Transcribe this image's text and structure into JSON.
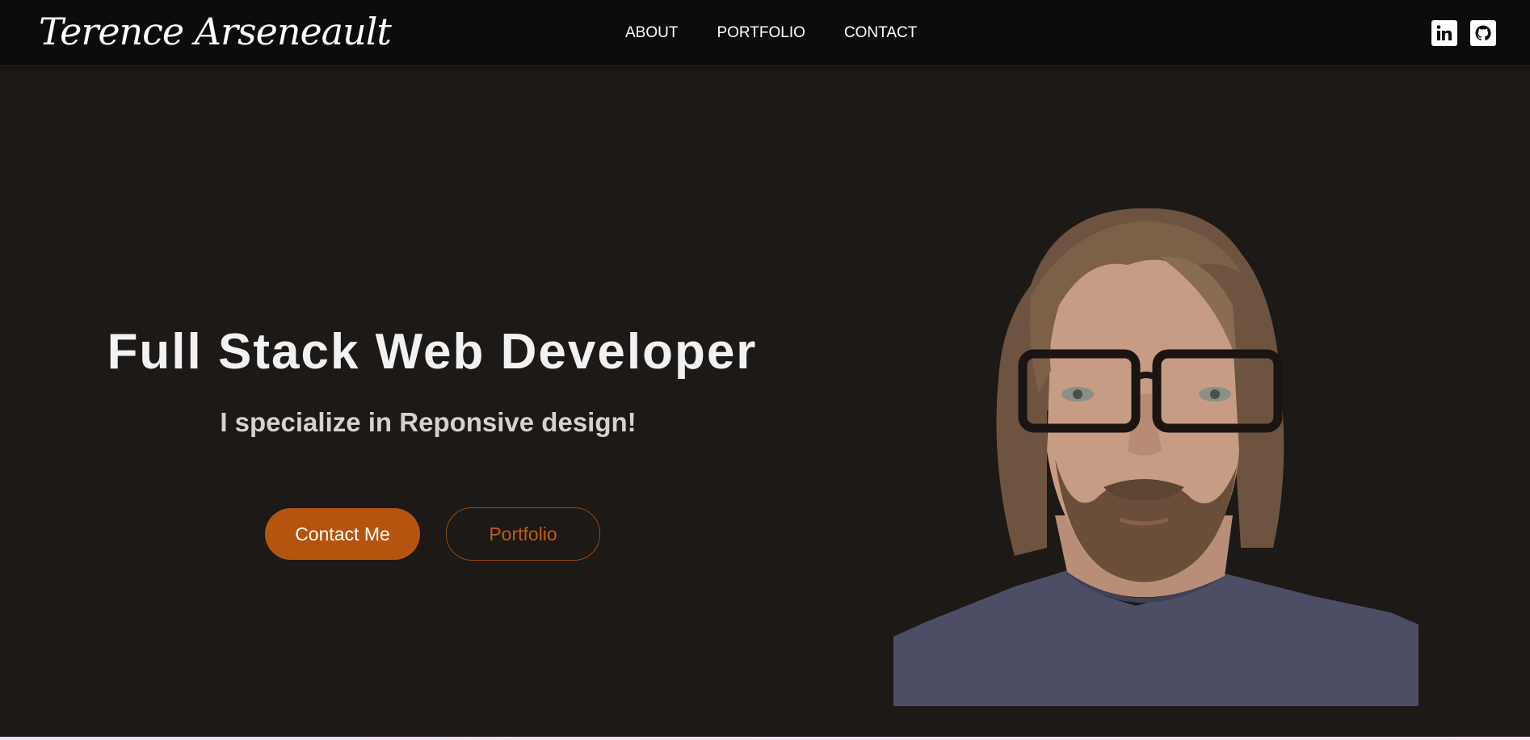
{
  "header": {
    "brand": "Terence Arseneault",
    "nav": [
      {
        "label": "ABOUT"
      },
      {
        "label": "PORTFOLIO"
      },
      {
        "label": "CONTACT"
      }
    ],
    "socials": [
      {
        "icon": "linkedin-icon"
      },
      {
        "icon": "github-icon"
      }
    ]
  },
  "hero": {
    "title": "Full Stack Web Developer",
    "subtitle": "I specialize in Reponsive design!",
    "primary_button": "Contact Me",
    "secondary_button": "Portfolio",
    "image": "portrait-photo"
  },
  "colors": {
    "background": "#1c1917",
    "navbar": "#0d0c0b",
    "accent": "#b5540f"
  }
}
